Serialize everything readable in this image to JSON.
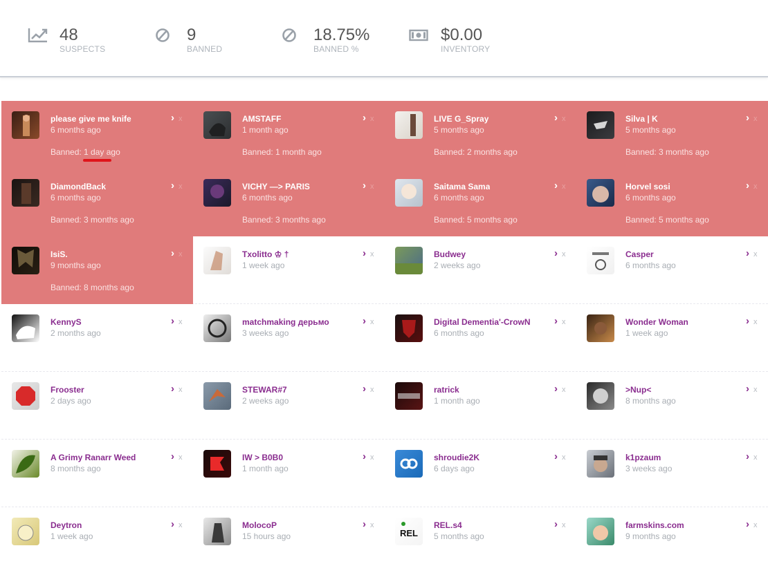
{
  "stats": [
    {
      "icon": "trend-chart-icon",
      "value": "48",
      "label": "SUSPECTS"
    },
    {
      "icon": "ban-icon",
      "value": "9",
      "label": "BANNED"
    },
    {
      "icon": "ban-icon",
      "value": "18.75%",
      "label": "BANNED %"
    },
    {
      "icon": "cash-icon",
      "value": "$0.00",
      "label": "INVENTORY"
    }
  ],
  "colors": {
    "banned_bg": "#e07b7b",
    "name_purple": "#8a2d8f",
    "muted_text": "#a8adb3",
    "annotation_red": "#e0141a"
  },
  "suspects": [
    {
      "name": "please give me knife",
      "time": "6 months ago",
      "banned": "Banned: 1 day ago",
      "avatar": "avatar-dark-figure"
    },
    {
      "name": "AMSTAFF",
      "time": "1 month ago",
      "banned": "Banned: 1 month ago",
      "avatar": "avatar-dog"
    },
    {
      "name": "LIVE G_Spray",
      "time": "5 months ago",
      "banned": "Banned: 2 months ago",
      "avatar": "avatar-light-figure"
    },
    {
      "name": "Silva | K",
      "time": "5 months ago",
      "banned": "Banned: 3 months ago",
      "avatar": "avatar-dark-logo"
    },
    {
      "name": "DiamondBack",
      "time": "6 months ago",
      "banned": "Banned: 3 months ago",
      "avatar": "avatar-dark-room"
    },
    {
      "name": "VICHY —> PARIS",
      "time": "6 months ago",
      "banned": "Banned: 3 months ago",
      "avatar": "avatar-purple-face"
    },
    {
      "name": "Saitama Sama",
      "time": "6 months ago",
      "banned": "Banned: 5 months ago",
      "avatar": "avatar-anime"
    },
    {
      "name": "Horvel sosi",
      "time": "6 months ago",
      "banned": "Banned: 5 months ago",
      "avatar": "avatar-blue-photo"
    },
    {
      "name": "IsiS.",
      "time": "9 months ago",
      "banned": "Banned: 8 months ago",
      "avatar": "avatar-butterfly"
    },
    {
      "name": "Txolitto ♔ †",
      "time": "1 week ago",
      "banned": "",
      "avatar": "avatar-sketch"
    },
    {
      "name": "Budwey",
      "time": "2 weeks ago",
      "banned": "",
      "avatar": "avatar-landscape"
    },
    {
      "name": "Casper",
      "time": "6 months ago",
      "banned": "",
      "avatar": "avatar-ghost-text"
    },
    {
      "name": "KennyS",
      "time": "2 months ago",
      "banned": "",
      "avatar": "avatar-bw-figure"
    },
    {
      "name": "matchmaking дерьмо",
      "time": "3 weeks ago",
      "banned": "",
      "avatar": "avatar-bw-logo"
    },
    {
      "name": "Digital Dementia'-CrowN",
      "time": "6 months ago",
      "banned": "",
      "avatar": "avatar-red-shield"
    },
    {
      "name": "Wonder Woman",
      "time": "1 week ago",
      "banned": "",
      "avatar": "avatar-woman"
    },
    {
      "name": "Frooster",
      "time": "2 days ago",
      "banned": "",
      "avatar": "avatar-stop-sign"
    },
    {
      "name": "STEWAR#7",
      "time": "2 weeks ago",
      "banned": "",
      "avatar": "avatar-bird"
    },
    {
      "name": "ratrick",
      "time": "1 month ago",
      "banned": "",
      "avatar": "avatar-ratrick"
    },
    {
      "name": ">Nup<",
      "time": "8 months ago",
      "banned": "",
      "avatar": "avatar-bw-face"
    },
    {
      "name": "A Grimy Ranarr Weed",
      "time": "8 months ago",
      "banned": "",
      "avatar": "avatar-leaf"
    },
    {
      "name": "IW > B0B0",
      "time": "1 month ago",
      "banned": "",
      "avatar": "avatar-faze"
    },
    {
      "name": "shroudie2K",
      "time": "6 days ago",
      "banned": "",
      "avatar": "avatar-cloud9"
    },
    {
      "name": "k1pzaum",
      "time": "3 weeks ago",
      "banned": "",
      "avatar": "avatar-man-cap"
    },
    {
      "name": "Deytron",
      "time": "1 week ago",
      "banned": "",
      "avatar": "avatar-cartoon-cat"
    },
    {
      "name": "MolocoP",
      "time": "15 hours ago",
      "banned": "",
      "avatar": "avatar-soldier"
    },
    {
      "name": "REL.s4",
      "time": "5 months ago",
      "banned": "",
      "avatar": "avatar-rel-logo"
    },
    {
      "name": "farmskins.com",
      "time": "9 months ago",
      "banned": "",
      "avatar": "avatar-cartoon-man"
    }
  ],
  "card_icons": {
    "open": "chevron-right-icon",
    "remove": "close-icon"
  },
  "close_glyph": "x",
  "chevron_glyph": "›"
}
